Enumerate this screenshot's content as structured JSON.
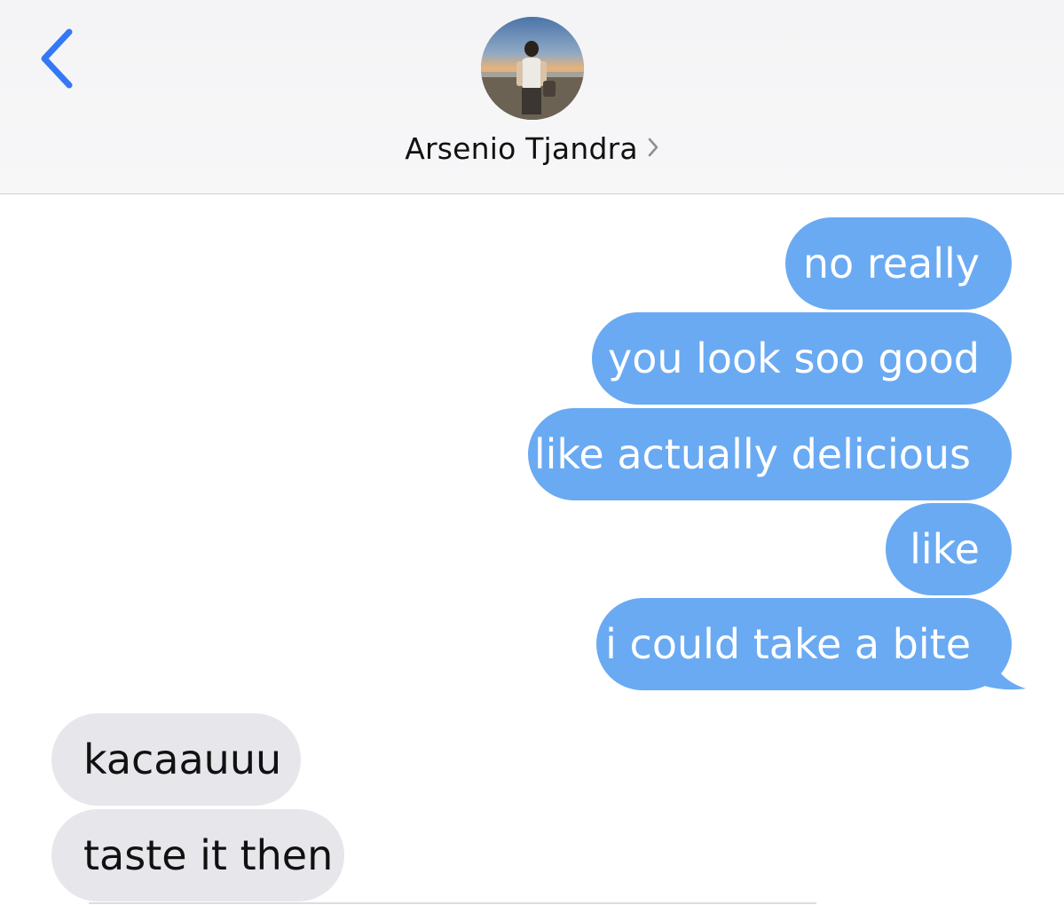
{
  "header": {
    "contact_name": "Arsenio Tjandra",
    "back_icon": "chevron-left-icon",
    "detail_icon": "chevron-right-icon",
    "avatar": "contact-avatar-photo"
  },
  "messages": [
    {
      "direction": "sent",
      "text": "no really"
    },
    {
      "direction": "sent",
      "text": "you look soo good"
    },
    {
      "direction": "sent",
      "text": "like actually delicious"
    },
    {
      "direction": "sent",
      "text": "like"
    },
    {
      "direction": "sent",
      "text": "i could take a bite"
    },
    {
      "direction": "received",
      "text": "kacaauuu"
    },
    {
      "direction": "received",
      "text": "taste it then"
    }
  ],
  "colors": {
    "sent_bubble": "#6aaaf2",
    "received_bubble": "#e6e6eb",
    "accent": "#3478f6"
  }
}
